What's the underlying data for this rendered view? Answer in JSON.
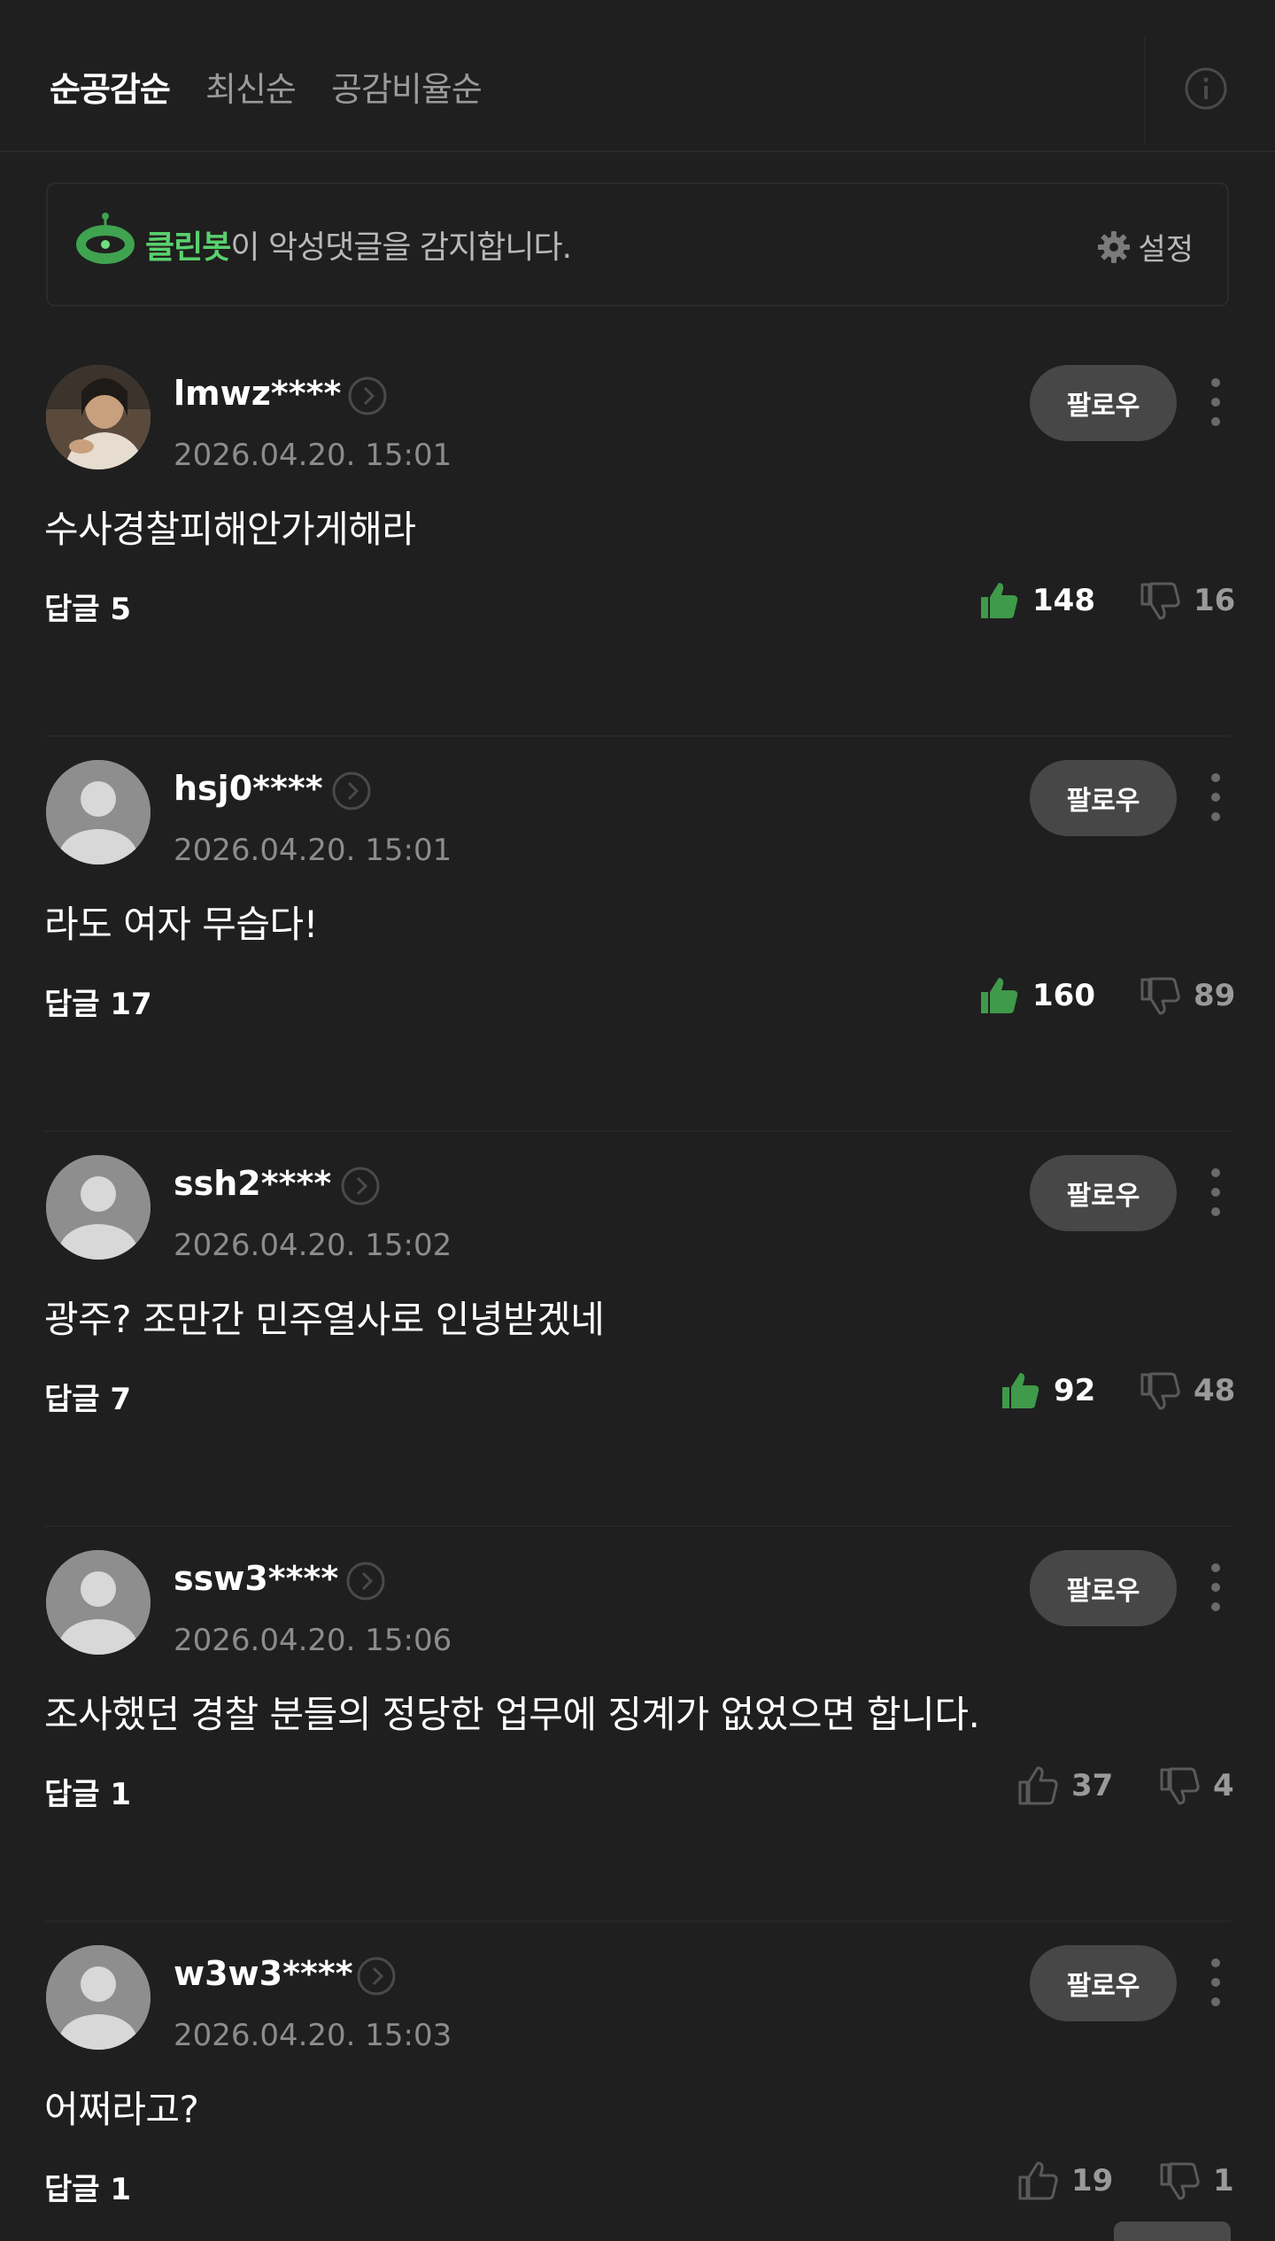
{
  "sort_tabs": [
    {
      "label": "순공감순",
      "active": true
    },
    {
      "label": "최신순",
      "active": false
    },
    {
      "label": "공감비율순",
      "active": false
    }
  ],
  "cleanbot": {
    "name": "클린봇",
    "message": "이 악성댓글을 감지합니다.",
    "settings_label": "설정"
  },
  "comments": [
    {
      "username": "lmwz****",
      "timestamp": "2026.04.20. 15:01",
      "follow_label": "팔로우",
      "body": "수사경찰피해안가게해라",
      "reply_label": "답글 5",
      "likes": "148",
      "dislikes": "16",
      "liked": true,
      "avatar": "photo"
    },
    {
      "username": "hsj0****",
      "timestamp": "2026.04.20. 15:01",
      "follow_label": "팔로우",
      "body": "라도 여자 무습다!",
      "reply_label": "답글 17",
      "likes": "160",
      "dislikes": "89",
      "liked": true,
      "avatar": "default"
    },
    {
      "username": "ssh2****",
      "timestamp": "2026.04.20. 15:02",
      "follow_label": "팔로우",
      "body": "광주? 조만간 민주열사로 인녕받겠네",
      "reply_label": "답글 7",
      "likes": "92",
      "dislikes": "48",
      "liked": true,
      "avatar": "default"
    },
    {
      "username": "ssw3****",
      "timestamp": "2026.04.20. 15:06",
      "follow_label": "팔로우",
      "body": "조사했던 경찰 분들의 정당한 업무에 징계가 없었으면 합니다.",
      "reply_label": "답글 1",
      "likes": "37",
      "dislikes": "4",
      "liked": false,
      "avatar": "default"
    },
    {
      "username": "w3w3****",
      "timestamp": "2026.04.20. 15:03",
      "follow_label": "팔로우",
      "body": "어쩌라고?",
      "reply_label": "답글 1",
      "likes": "19",
      "dislikes": "1",
      "liked": false,
      "avatar": "default"
    }
  ],
  "colors": {
    "background": "#1f1f1f",
    "accent_green": "#59d16d",
    "like_green": "#3f9a4a",
    "muted_text": "#8c8c8c"
  },
  "icons": [
    "info-icon",
    "cleanbot-icon",
    "gear-icon",
    "profile-arrow-icon",
    "more-icon",
    "thumbs-up-icon",
    "thumbs-down-icon"
  ]
}
